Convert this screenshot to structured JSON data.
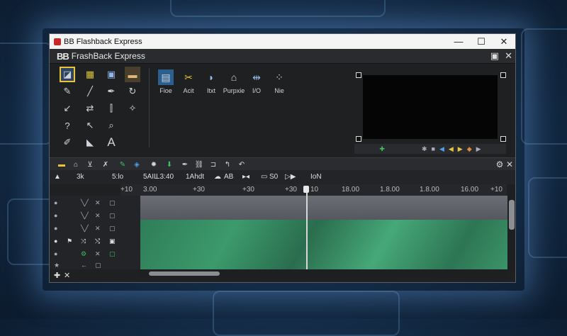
{
  "app": {
    "window_title": "BB Flashback Express",
    "inner_title_brand": "BB",
    "inner_title_text": "FrashBack Express"
  },
  "window_controls": {
    "minimize": "—",
    "maximize": "☐",
    "close": "✕"
  },
  "inner_controls": {
    "restore": "▣",
    "close": "✕"
  },
  "actions": [
    {
      "label": "Fioe",
      "icon": "film-icon"
    },
    {
      "label": "Acit",
      "icon": "scissors-icon"
    },
    {
      "label": "Itxt",
      "icon": "text-icon"
    },
    {
      "label": "Purpxie",
      "icon": "house-icon"
    },
    {
      "label": "I/O",
      "icon": "split-icon"
    },
    {
      "label": "Nie",
      "icon": "grid-icon"
    }
  ],
  "timeline_header": {
    "zoom": "3k",
    "field1": "5:lo",
    "field2": "5AIL",
    "field3": "L3:40",
    "field4": "1Ahdt",
    "field5": "AB",
    "field6": "S0",
    "field7": "IoN"
  },
  "ruler": [
    "+10",
    "3.00",
    "+30",
    "+30",
    "+30",
    "10",
    "18.00",
    "1.8.00",
    "1.8.00",
    "16.00",
    "+10"
  ],
  "colors": {
    "accent": "#e8c43a",
    "track_green": "#3c9a6c",
    "track_grey": "#6b6e74"
  }
}
